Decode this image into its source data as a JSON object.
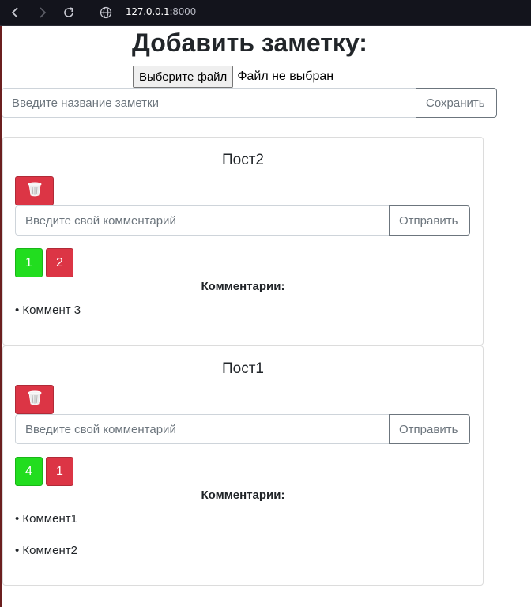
{
  "browser": {
    "url_host": "127.0.0.1:",
    "url_port": "8000",
    "back_icon": "chevron-left-icon",
    "forward_icon": "chevron-right-icon",
    "reload_icon": "reload-icon",
    "site_icon": "globe-icon"
  },
  "header": {
    "title": "Добавить заметку:",
    "file_button_label": "Выберите файл",
    "file_status": "Файл не выбран",
    "note_placeholder": "Введите название заметки",
    "save_label": "Сохранить"
  },
  "posts": [
    {
      "title": "Пост2",
      "comment_placeholder": "Введите свой комментарий",
      "send_label": "Отправить",
      "likes": "1",
      "dislikes": "2",
      "comments_heading": "Комментарии:",
      "comments": [
        "• Коммент 3"
      ]
    },
    {
      "title": "Пост1",
      "comment_placeholder": "Введите свой комментарий",
      "send_label": "Отправить",
      "likes": "4",
      "dislikes": "1",
      "comments_heading": "Комментарии:",
      "comments": [
        "• Коммент1",
        "• Коммент2"
      ]
    }
  ],
  "colors": {
    "like": "#22dd1f",
    "dislike": "#dc3545",
    "delete": "#dc3545",
    "browser_bar": "#13141c"
  }
}
